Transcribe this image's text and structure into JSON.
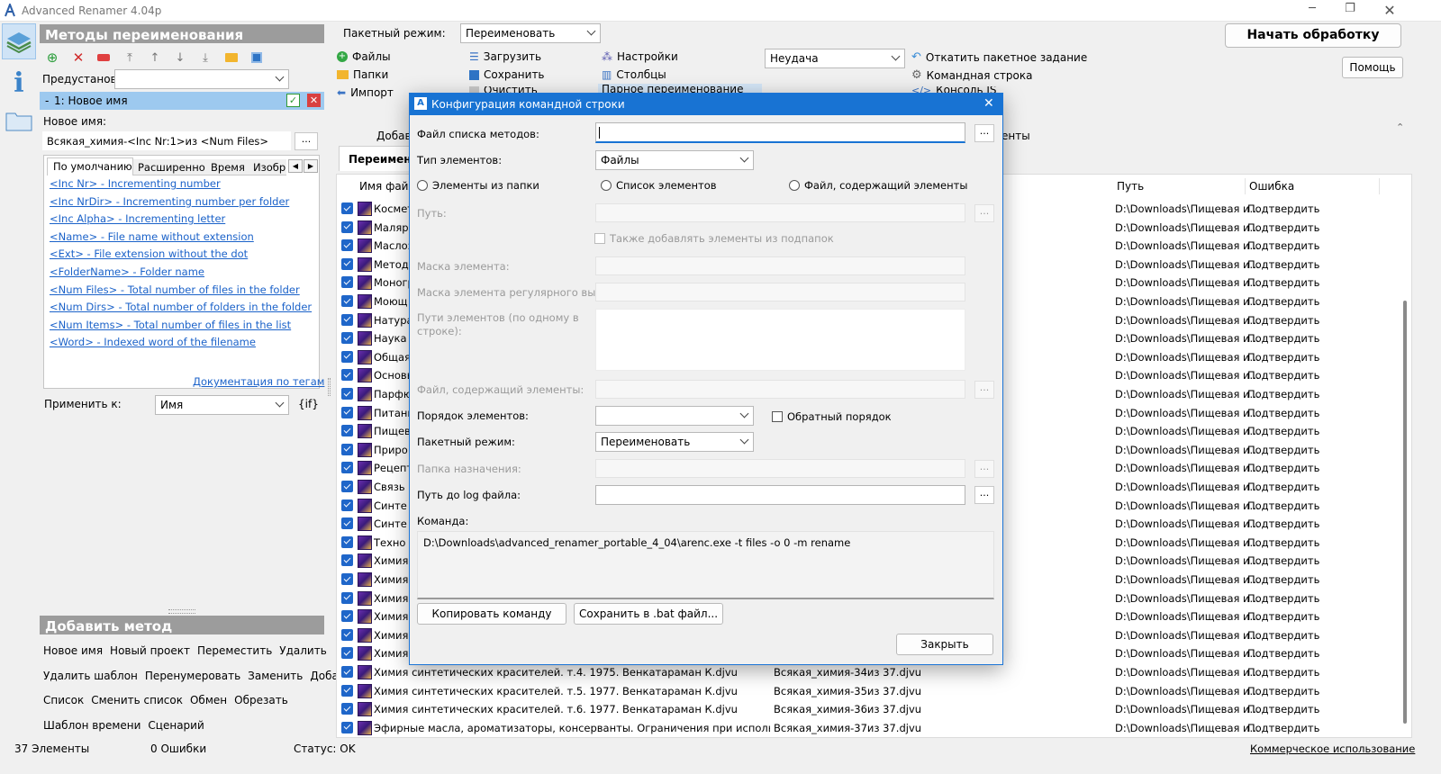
{
  "app": {
    "title": "Advanced Renamer 4.04p"
  },
  "methods": {
    "header": "Методы переименования",
    "presets_label": "Предустановки",
    "presets_value": "",
    "method_item": "1: Новое имя",
    "new_name_label": "Новое имя:",
    "new_name_value": "Всякая_химия-<Inc Nr:1>из <Num Files>",
    "tabs": [
      "По умолчанию",
      "Расширенно",
      "Время",
      "Изобр"
    ],
    "tags": [
      "<Inc Nr>  - Incrementing number",
      "<Inc NrDir>  - Incrementing number per folder",
      "<Inc Alpha>  - Incrementing letter",
      "<Name>  - File name without extension",
      "<Ext>  - File extension without the dot",
      "<FolderName>  - Folder name",
      "<Num Files>  - Total number of files in the folder",
      "<Num Dirs>  - Total number of folders in the folder",
      "<Num Items>  - Total number of files in the list",
      "<Word>  - Indexed word of the filename"
    ],
    "doc_link": "Документация по тегам",
    "apply_label": "Применить к:",
    "apply_value": "Имя",
    "if_label": "{if}"
  },
  "add_method": {
    "header": "Добавить метод",
    "rows": [
      [
        "Новое имя",
        "Новый проект",
        "Переместить",
        "Удалить"
      ],
      [
        "Удалить шаблон",
        "Перенумеровать",
        "Заменить",
        "Добавить"
      ],
      [
        "Список",
        "Сменить список",
        "Обмен",
        "Обрезать"
      ],
      [
        "Шаблон времени",
        "Сценарий"
      ]
    ]
  },
  "toolbar": {
    "batch_mode_label": "Пакетный режим:",
    "batch_mode_value": "Переименовать",
    "files": "Файлы",
    "folders": "Папки",
    "import": "Импорт",
    "load": "Загрузить",
    "save": "Сохранить",
    "clear": "Очистить",
    "settings": "Настройки",
    "columns": "Столбцы",
    "pair_rename": "Парное переименование",
    "filter_value": "Неудача",
    "rollback": "Откатить пакетное задание",
    "command_line": "Командная строка",
    "console": "Консоль JS",
    "start": "Начать обработку",
    "help": "Помощь",
    "add_label": "Добав",
    "elements_label": "енты",
    "rename_tab": "Переимено"
  },
  "table": {
    "col_name": "Имя файл",
    "col_path": "Путь",
    "col_error": "Ошибка",
    "rows": [
      {
        "name": "Космет",
        "new": "",
        "path": "D:\\Downloads\\Пищевая и...",
        "error": "Подтвердить"
      },
      {
        "name": "Маляр",
        "new": "",
        "path": "D:\\Downloads\\Пищевая и...",
        "error": "Подтвердить"
      },
      {
        "name": "Маслоз",
        "new": "",
        "path": "D:\\Downloads\\Пищевая и...",
        "error": "Подтвердить"
      },
      {
        "name": "Методы",
        "new": "",
        "path": "D:\\Downloads\\Пищевая и...",
        "error": "Подтвердить"
      },
      {
        "name": "Моногр",
        "new": "",
        "path": "D:\\Downloads\\Пищевая и...",
        "error": "Подтвердить"
      },
      {
        "name": "Моющ",
        "new": "",
        "path": "D:\\Downloads\\Пищевая и...",
        "error": "Подтвердить"
      },
      {
        "name": "Натура",
        "new": "",
        "path": "D:\\Downloads\\Пищевая и...",
        "error": "Подтвердить"
      },
      {
        "name": "Наука с",
        "new": "",
        "path": "D:\\Downloads\\Пищевая и...",
        "error": "Подтвердить"
      },
      {
        "name": "Общая",
        "new": "",
        "path": "D:\\Downloads\\Пищевая и...",
        "error": "Подтвердить"
      },
      {
        "name": "Основь",
        "new": "",
        "path": "D:\\Downloads\\Пищевая и...",
        "error": "Подтвердить"
      },
      {
        "name": "Парфю",
        "new": "",
        "path": "D:\\Downloads\\Пищевая и...",
        "error": "Подтвердить"
      },
      {
        "name": "Питани",
        "new": "",
        "path": "D:\\Downloads\\Пищевая и...",
        "error": "Подтвердить"
      },
      {
        "name": "Пищев",
        "new": "",
        "path": "D:\\Downloads\\Пищевая и...",
        "error": "Подтвердить"
      },
      {
        "name": "Приро",
        "new": "",
        "path": "D:\\Downloads\\Пищевая и...",
        "error": "Подтвердить"
      },
      {
        "name": "Рецепт",
        "new": "",
        "path": "D:\\Downloads\\Пищевая и...",
        "error": "Подтвердить"
      },
      {
        "name": "Связь м",
        "new": "",
        "path": "D:\\Downloads\\Пищевая и...",
        "error": "Подтвердить"
      },
      {
        "name": "Синте",
        "new": "",
        "path": "D:\\Downloads\\Пищевая и...",
        "error": "Подтвердить"
      },
      {
        "name": "Синте",
        "new": "",
        "path": "D:\\Downloads\\Пищевая и...",
        "error": "Подтвердить"
      },
      {
        "name": "Техно",
        "new": "",
        "path": "D:\\Downloads\\Пищевая и...",
        "error": "Подтвердить"
      },
      {
        "name": "Химия",
        "new": "",
        "path": "D:\\Downloads\\Пищевая и...",
        "error": "Подтвердить"
      },
      {
        "name": "Химия",
        "new": "",
        "path": "D:\\Downloads\\Пищевая и...",
        "error": "Подтвердить"
      },
      {
        "name": "Химия",
        "new": "",
        "path": "D:\\Downloads\\Пищевая и...",
        "error": "Подтвердить"
      },
      {
        "name": "Химия",
        "new": "",
        "path": "D:\\Downloads\\Пищевая и...",
        "error": "Подтвердить"
      },
      {
        "name": "Химия",
        "new": "",
        "path": "D:\\Downloads\\Пищевая и...",
        "error": "Подтвердить"
      },
      {
        "name": "Химия",
        "new": "",
        "path": "D:\\Downloads\\Пищевая и...",
        "error": "Подтвердить"
      },
      {
        "name": "Химия синтетических красителей. т.4. 1975. Венкатараман К.djvu",
        "new": "Всякая_химия-34из 37.djvu",
        "path": "D:\\Downloads\\Пищевая и...",
        "error": "Подтвердить"
      },
      {
        "name": "Химия синтетических красителей. т.5. 1977. Венкатараман К.djvu",
        "new": "Всякая_химия-35из 37.djvu",
        "path": "D:\\Downloads\\Пищевая и...",
        "error": "Подтвердить"
      },
      {
        "name": "Химия синтетических красителей. т.6. 1977. Венкатараман К.djvu",
        "new": "Всякая_химия-36из 37.djvu",
        "path": "D:\\Downloads\\Пищевая и...",
        "error": "Подтвердить"
      },
      {
        "name": "Эфирные масла, ароматизаторы, консерванты. Ограничения при использовани...",
        "new": "Всякая_химия-37из 37.djvu",
        "path": "D:\\Downloads\\Пищевая и...",
        "error": "Подтвердить"
      }
    ]
  },
  "status": {
    "elements": "37 Элементы",
    "errors": "0 Ошибки",
    "status": "Статус: OK",
    "commercial": "Коммерческое использование"
  },
  "dialog": {
    "title": "Конфигурация командной строки",
    "methods_file_label": "Файл списка методов:",
    "elements_type_label": "Тип элементов:",
    "elements_type_value": "Файлы",
    "radio_folder": "Элементы из папки",
    "radio_list": "Список элементов",
    "radio_file": "Файл, содержащий элементы",
    "paths_label": "Путь:",
    "subfolders_label": "Также добавлять элементы из подпапок",
    "mask_label": "Маска элемента:",
    "regex_mask_label": "Маска элемента регулярного выраж",
    "element_paths_label": "Пути элементов (по одному в строке):",
    "file_with_elements_label": "Файл, содержащий элементы:",
    "order_label": "Порядок элементов:",
    "reverse_label": "Обратный порядок",
    "batch_label": "Пакетный режим:",
    "batch_value": "Переименовать",
    "dest_label": "Папка назначения:",
    "log_label": "Путь до log файла:",
    "command_label": "Команда:",
    "command_value": "D:\\Downloads\\advanced_renamer_portable_4_04\\arenc.exe -t files -o 0 -m rename",
    "copy_btn": "Копировать команду",
    "save_bat_btn": "Сохранить в .bat файл...",
    "close_btn": "Закрыть",
    "dots": "..."
  }
}
